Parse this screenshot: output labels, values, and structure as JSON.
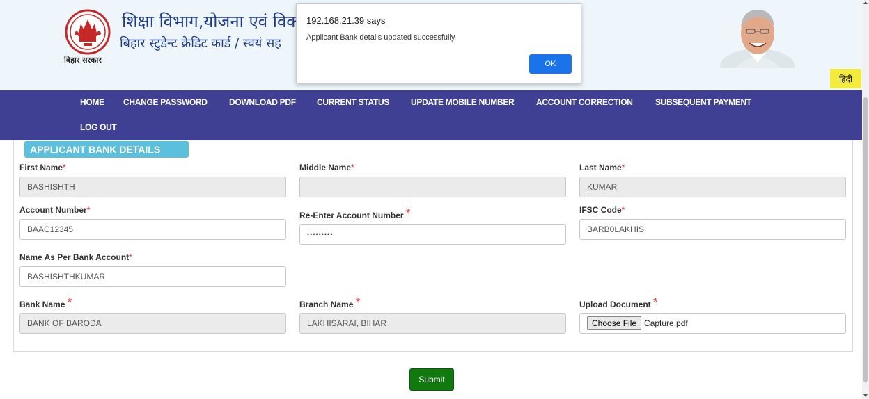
{
  "header": {
    "title": "शिक्षा विभाग,योजना एवं विक",
    "subtitle": "बिहार स्टुडेन्ट क्रेडिट कार्ड / स्वयं सह",
    "emblem_caption": "बिहार सरकार",
    "emblem_icon": "bihar-emblem-icon",
    "photo_icon": "chief-minister-portrait",
    "language_button": "हिंदी"
  },
  "nav": {
    "items": [
      "HOME",
      "CHANGE PASSWORD",
      "DOWNLOAD PDF",
      "CURRENT STATUS",
      "UPDATE MOBILE NUMBER",
      "ACCOUNT CORRECTION",
      "SUBSEQUENT PAYMENT",
      "LOG OUT"
    ]
  },
  "form": {
    "section_title": "APPLICANT BANK DETAILS",
    "first_name": {
      "label": "First Name",
      "value": "BASHISHTH"
    },
    "middle_name": {
      "label": "Middle Name",
      "value": ""
    },
    "last_name": {
      "label": "Last Name",
      "value": "KUMAR"
    },
    "account_number": {
      "label": "Account Number",
      "value": "BAAC12345"
    },
    "reenter_account": {
      "label": "Re-Enter Account Number",
      "value": "•••••••••"
    },
    "ifsc": {
      "label": "IFSC Code",
      "value": "BARB0LAKHIS"
    },
    "name_per_bank": {
      "label": "Name As Per Bank Account",
      "value": "BASHISHTHKUMAR"
    },
    "bank_name": {
      "label": "Bank Name",
      "value": "BANK OF BARODA"
    },
    "branch_name": {
      "label": "Branch Name",
      "value": "LAKHISARAI, BIHAR"
    },
    "upload": {
      "label": "Upload Document",
      "button": "Choose File",
      "file": "Capture.pdf"
    },
    "required_mark": "*",
    "submit": "Submit"
  },
  "dialog": {
    "title": "192.168.21.39 says",
    "message": "Applicant Bank details updated successfully",
    "ok": "OK"
  },
  "colors": {
    "nav_bg": "#3f3f93",
    "badge_bg": "#5bc0de",
    "submit_bg": "#117a0e",
    "dialog_ok_bg": "#1a73e8",
    "lang_bg": "#f3ec3d"
  }
}
